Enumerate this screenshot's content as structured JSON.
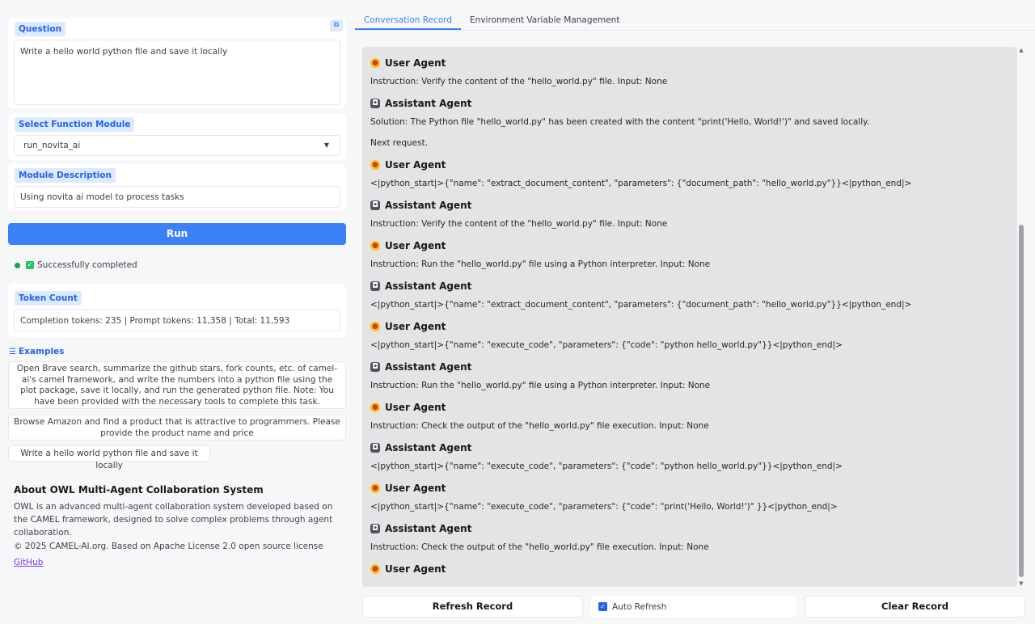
{
  "question": {
    "label": "Question",
    "value": "Write a hello world python file and save it locally"
  },
  "module": {
    "label": "Select Function Module",
    "selected": "run_novita_ai"
  },
  "description": {
    "label": "Module Description",
    "value": "Using novita ai model to process tasks"
  },
  "run_button": "Run",
  "status": "Successfully completed",
  "token": {
    "label": "Token Count",
    "value": "Completion tokens: 235 | Prompt tokens: 11,358 | Total: 11,593"
  },
  "examples": {
    "label": "Examples",
    "items": [
      "Open Brave search, summarize the github stars, fork counts, etc. of camel-ai's camel framework, and write the numbers into a python file using the plot package, save it locally, and run the generated python file. Note: You have been provided with the necessary tools to complete this task.",
      "Browse Amazon and find a product that is attractive to programmers. Please provide the product name and price",
      "Write a hello world python file and save it locally"
    ]
  },
  "about": {
    "title": "About OWL Multi-Agent Collaboration System",
    "text": "OWL is an advanced multi-agent collaboration system developed based on the CAMEL framework, designed to solve complex problems through agent collaboration.",
    "copyright": "© 2025 CAMEL-AI.org. Based on Apache License 2.0 open source license",
    "link": "GitHub"
  },
  "tabs": [
    "Conversation Record",
    "Environment Variable Management"
  ],
  "messages": [
    {
      "agent": "User Agent",
      "type": "user",
      "lines": [
        "Instruction: Verify the content of the \"hello_world.py\" file. Input: None"
      ]
    },
    {
      "agent": "Assistant Agent",
      "type": "assistant",
      "lines": [
        "Solution: The Python file \"hello_world.py\" has been created with the content \"print('Hello, World!')\" and saved locally.",
        "Next request."
      ]
    },
    {
      "agent": "User Agent",
      "type": "user",
      "lines": [
        "<|python_start|>{\"name\": \"extract_document_content\", \"parameters\": {\"document_path\": \"hello_world.py\"}}<|python_end|>"
      ]
    },
    {
      "agent": "Assistant Agent",
      "type": "assistant",
      "lines": [
        "Instruction: Verify the content of the \"hello_world.py\" file. Input: None"
      ]
    },
    {
      "agent": "User Agent",
      "type": "user",
      "lines": [
        "Instruction: Run the \"hello_world.py\" file using a Python interpreter. Input: None"
      ]
    },
    {
      "agent": "Assistant Agent",
      "type": "assistant",
      "lines": [
        "<|python_start|>{\"name\": \"extract_document_content\", \"parameters\": {\"document_path\": \"hello_world.py\"}}<|python_end|>"
      ]
    },
    {
      "agent": "User Agent",
      "type": "user",
      "lines": [
        "<|python_start|>{\"name\": \"execute_code\", \"parameters\": {\"code\": \"python hello_world.py\"}}<|python_end|>"
      ]
    },
    {
      "agent": "Assistant Agent",
      "type": "assistant",
      "lines": [
        "Instruction: Run the \"hello_world.py\" file using a Python interpreter. Input: None"
      ]
    },
    {
      "agent": "User Agent",
      "type": "user",
      "lines": [
        "Instruction: Check the output of the \"hello_world.py\" file execution. Input: None"
      ]
    },
    {
      "agent": "Assistant Agent",
      "type": "assistant",
      "lines": [
        "<|python_start|>{\"name\": \"execute_code\", \"parameters\": {\"code\": \"python hello_world.py\"}}<|python_end|>"
      ]
    },
    {
      "agent": "User Agent",
      "type": "user",
      "lines": [
        "<|python_start|>{\"name\": \"execute_code\", \"parameters\": {\"code\": \"print('Hello, World!')\" }}<|python_end|>"
      ]
    },
    {
      "agent": "Assistant Agent",
      "type": "assistant",
      "lines": [
        "Instruction: Check the output of the \"hello_world.py\" file execution. Input: None"
      ]
    },
    {
      "agent": "User Agent",
      "type": "user",
      "lines": []
    }
  ],
  "controls": {
    "refresh": "Refresh Record",
    "auto_refresh": "Auto Refresh",
    "clear": "Clear Record"
  },
  "colors": {
    "accent": "#3b82f6",
    "chip_bg": "#dbeafe",
    "success": "#22c55e",
    "link": "#7c3aed"
  }
}
